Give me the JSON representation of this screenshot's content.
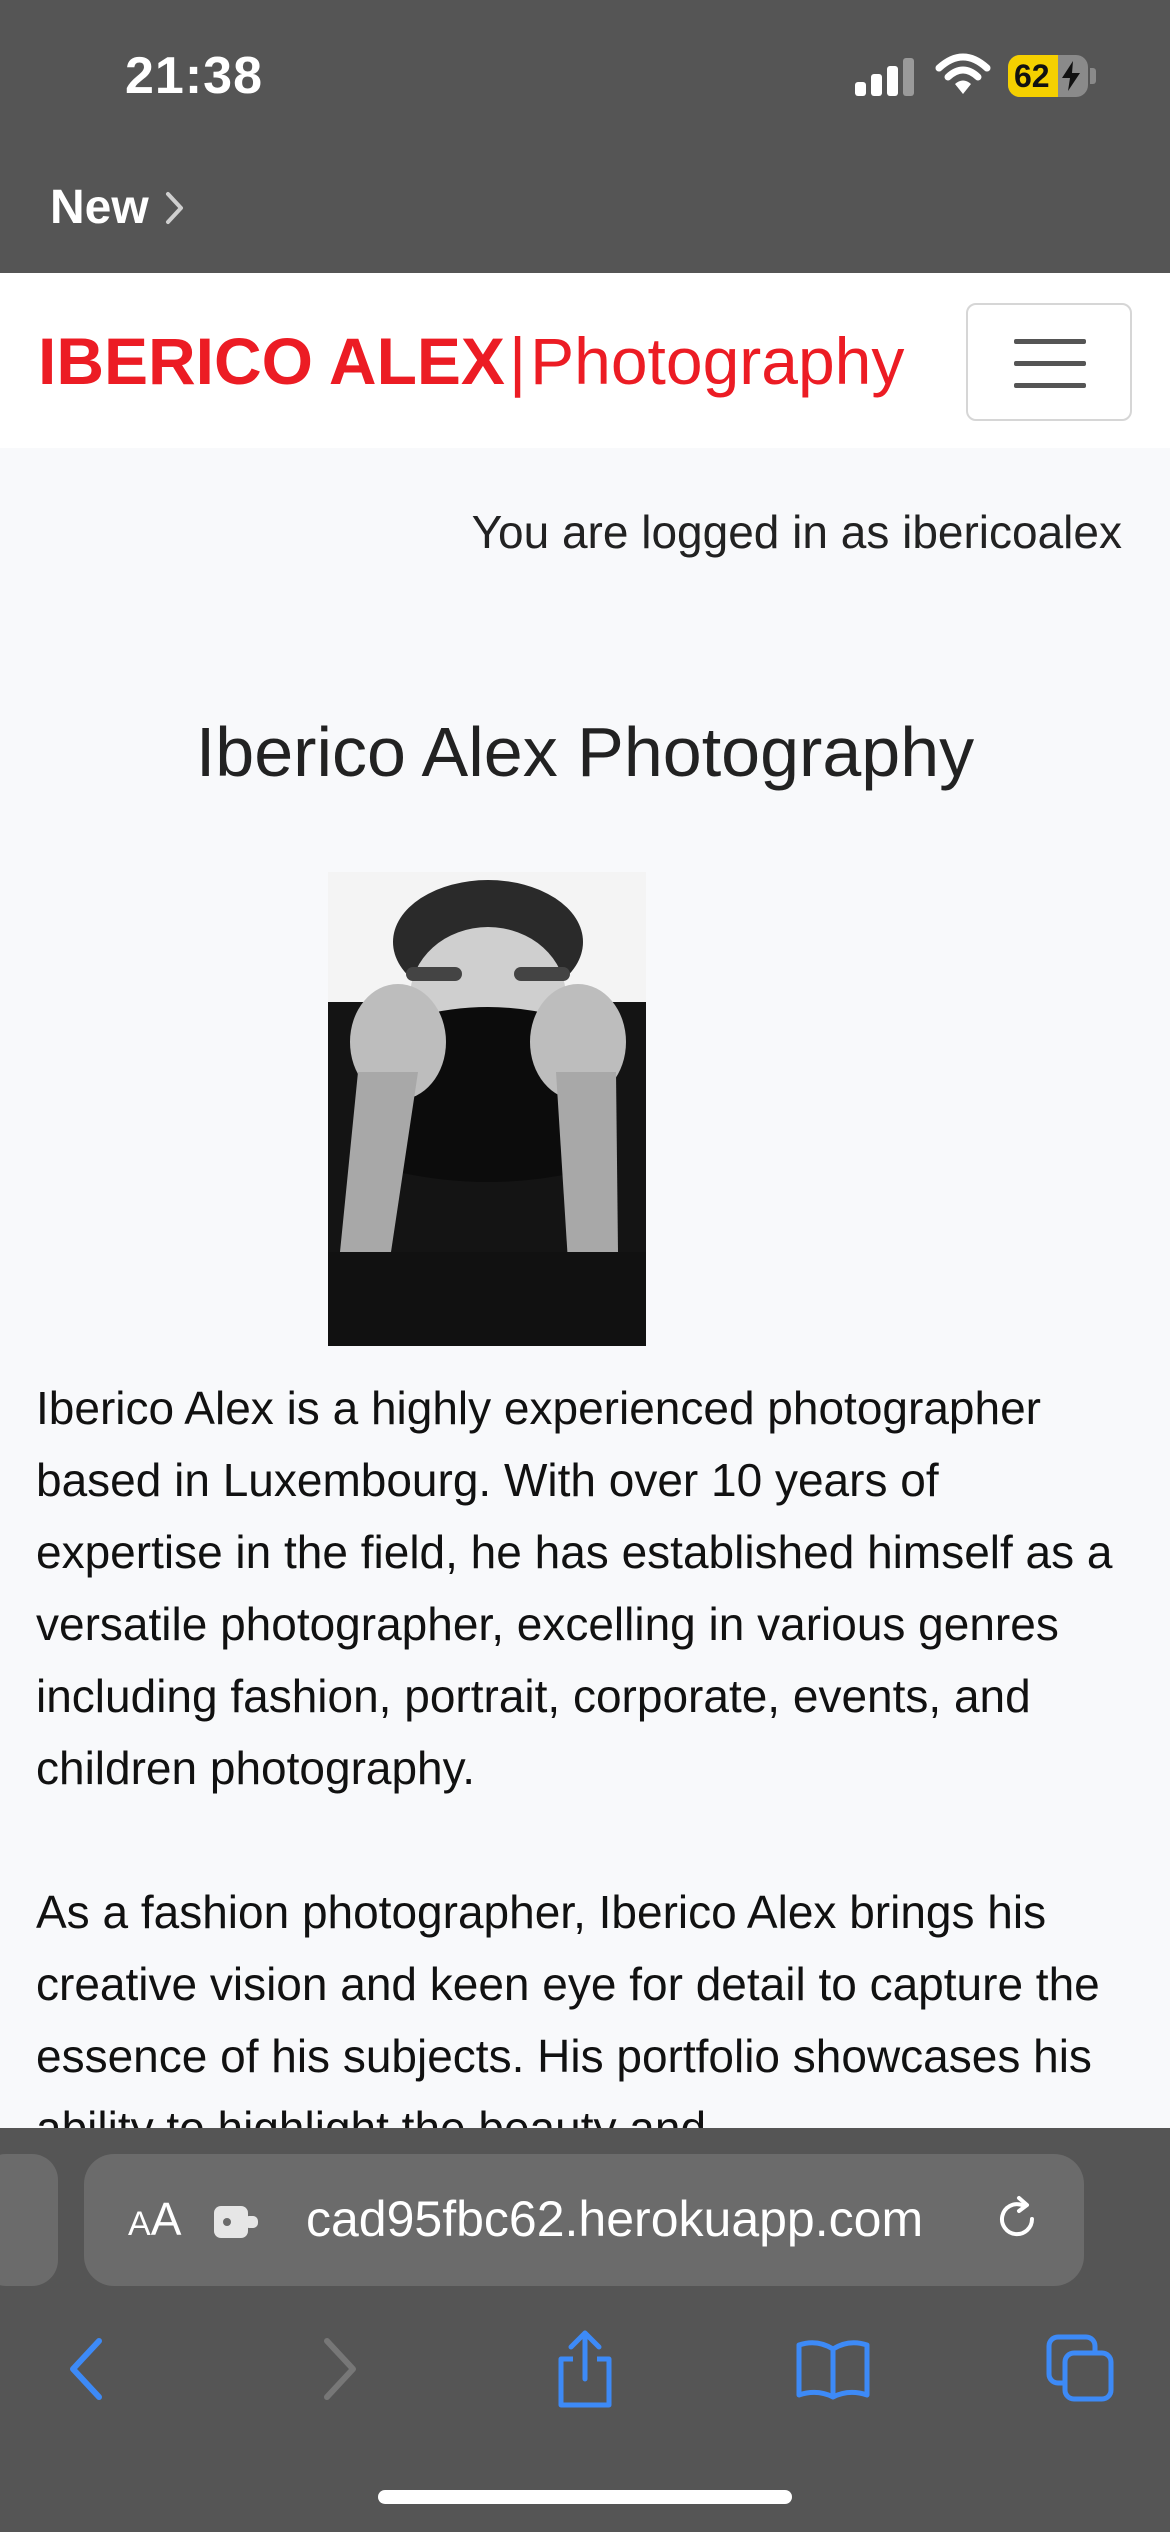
{
  "status_bar": {
    "time": "21:38",
    "battery_level": "62",
    "icons": [
      "signal-icon",
      "wifi-icon",
      "battery-charging-icon"
    ]
  },
  "app_nav": {
    "back_label": "New",
    "icon": "chevron-right-icon"
  },
  "site_navbar": {
    "brand_bold": "IBERICO ALEX",
    "brand_separator": "|",
    "brand_light": "Photography",
    "brand_color": "#ec1c24",
    "menu_icon": "hamburger-menu-icon"
  },
  "main": {
    "login_status": "You are logged in as ibericoalex",
    "title": "Iberico Alex Photography",
    "paragraphs": [
      "Iberico Alex is a highly experienced photographer based in Luxembourg. With over 10 years of expertise in the field, he has established himself as a versatile photographer, excelling in various genres including fashion, portrait, corporate, events, and children photography.",
      "As a fashion photographer, Iberico Alex brings his creative vision and keen eye for detail to capture the essence of his subjects. His portfolio showcases his ability to highlight the beauty and"
    ]
  },
  "browser": {
    "text_size_label": "AA",
    "url": "cad95fbc62.herokuapp.com",
    "toolbar_icons": [
      "back-icon",
      "forward-icon",
      "share-icon",
      "bookmarks-icon",
      "tabs-icon"
    ],
    "accent_color": "#3d8af7"
  }
}
